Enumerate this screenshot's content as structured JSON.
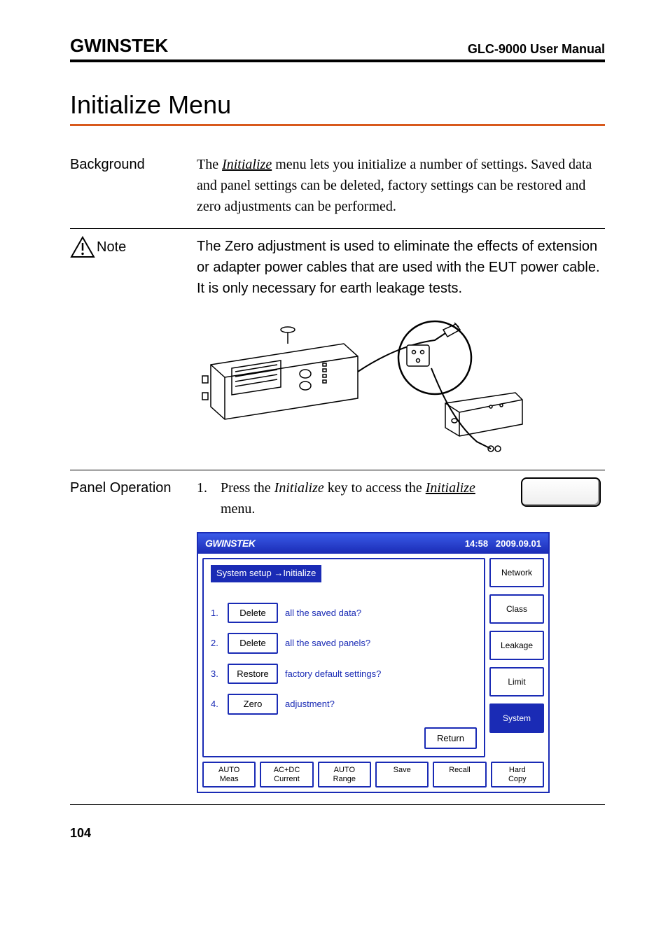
{
  "header": {
    "brand": "GWINSTEK",
    "manual": "GLC-9000 User Manual"
  },
  "title": "Initialize Menu",
  "background": {
    "label": "Background",
    "text_prefix": "The ",
    "text_link": "Initialize",
    "text_suffix": " menu lets you initialize a number of settings. Saved data and panel settings can be deleted, factory settings can be restored and zero adjustments can be performed."
  },
  "note": {
    "label": "Note",
    "text": "The Zero adjustment is used to eliminate the effects of extension or adapter power cables that are used with the EUT power cable. It is only necessary for earth leakage tests."
  },
  "panel_op": {
    "label": "Panel Operation",
    "step_num": "1.",
    "step_a": "Press the ",
    "step_key": "Initialize",
    "step_b": " key to access the ",
    "step_link": "Initialize",
    "step_c": " menu."
  },
  "screenshot": {
    "brand": "GWINSTEK",
    "time": "14:58",
    "date": "2009.09.01",
    "crumb": "System setup →Initialize",
    "rows": [
      {
        "n": "1.",
        "btn": "Delete",
        "lbl": "all the saved data?"
      },
      {
        "n": "2.",
        "btn": "Delete",
        "lbl": "all the saved panels?"
      },
      {
        "n": "3.",
        "btn": "Restore",
        "lbl": "factory default settings?"
      },
      {
        "n": "4.",
        "btn": "Zero",
        "lbl": "adjustment?"
      }
    ],
    "return": "Return",
    "side": [
      "Network",
      "Class",
      "Leakage",
      "Limit",
      "System"
    ],
    "bottom": [
      "AUTO\nMeas",
      "AC+DC\nCurrent",
      "AUTO\nRange",
      "Save",
      "Recall",
      "Hard\nCopy"
    ]
  },
  "page_number": "104"
}
